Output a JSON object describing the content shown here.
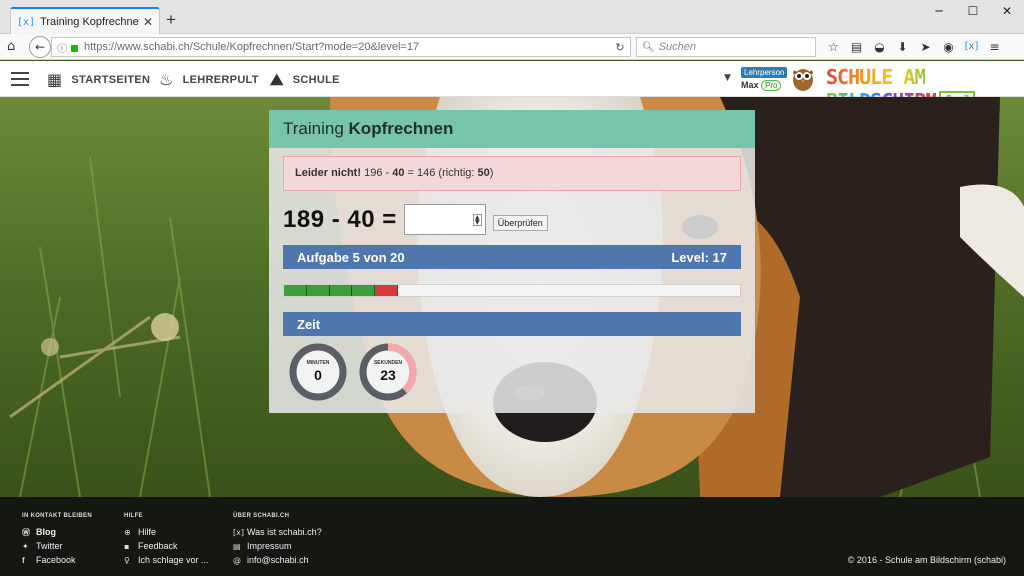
{
  "browser": {
    "tab_title": "Training Kopfrechnen - Schabi",
    "tab_favicon": "[x]",
    "url": "https://www.schabi.ch/Schule/Kopfrechnen/Start?mode=20&level=17",
    "search_placeholder": "Suchen",
    "window_controls": [
      "minimize-icon",
      "maximize-icon",
      "close-icon"
    ],
    "toolbar_icons": [
      "star-icon",
      "reading-list-icon",
      "pocket-icon",
      "download-icon",
      "send-icon",
      "sync-icon",
      "schabi-extension-icon",
      "menu-icon"
    ]
  },
  "site": {
    "nav": [
      {
        "label": "STARTSEITEN",
        "icon": "calendar-icon"
      },
      {
        "label": "LEHRERPULT",
        "icon": "desk-lamp-icon"
      },
      {
        "label": "SCHULE",
        "icon": "chart-icon"
      }
    ],
    "user": {
      "role": "Lehrperson",
      "name": "Max",
      "badge": "Pro"
    },
    "brand": "SCHULE AM BILDSCHIRM",
    "brand_mark": "[x]"
  },
  "training": {
    "title_prefix": "Training",
    "title_main": "Kopfrechnen",
    "feedback": {
      "label": "Leider nicht!",
      "expr_start": "196 - ",
      "expr_operand": "40",
      "expr_rest": " = 146 (richtig: ",
      "correct": "50",
      "close": ")"
    },
    "task": "189 - 40 =",
    "answer_value": "",
    "check_label": "Überprüfen",
    "progress_label": "Aufgabe 5 von 20",
    "level_label": "Level: 17",
    "progress": {
      "total": 20,
      "results": [
        "correct",
        "correct",
        "correct",
        "correct",
        "wrong"
      ],
      "colors": {
        "correct": "#3c9e3c",
        "wrong": "#d63a3a"
      }
    },
    "time_label": "Zeit",
    "timers": [
      {
        "label": "MINUTEN",
        "value": "0",
        "fraction": 0.0
      },
      {
        "label": "SEKUNDEN",
        "value": "23",
        "fraction": 0.383
      }
    ],
    "accent_color": "#77c4ad",
    "bar_color": "#4f77ae"
  },
  "footer": {
    "columns": [
      {
        "heading": "IN KONTAKT BLEIBEN",
        "items": [
          {
            "label": "Blog",
            "icon": "wordpress-icon",
            "bold": true
          },
          {
            "label": "Twitter",
            "icon": "twitter-icon"
          },
          {
            "label": "Facebook",
            "icon": "facebook-icon"
          }
        ]
      },
      {
        "heading": "HILFE",
        "items": [
          {
            "label": "Hilfe",
            "icon": "lifebuoy-icon"
          },
          {
            "label": "Feedback",
            "icon": "comments-icon"
          },
          {
            "label": "Ich schlage vor ...",
            "icon": "lightbulb-icon"
          }
        ]
      },
      {
        "heading": "ÜBER SCHABI.CH",
        "items": [
          {
            "label": "Was ist schabi.ch?",
            "icon": "schabi-x-icon"
          },
          {
            "label": "Impressum",
            "icon": "document-icon"
          },
          {
            "label": "info@schabi.ch",
            "icon": "at-icon"
          }
        ]
      }
    ],
    "copyright": "© 2016 - Schule am Bildschirm (schabi)"
  }
}
